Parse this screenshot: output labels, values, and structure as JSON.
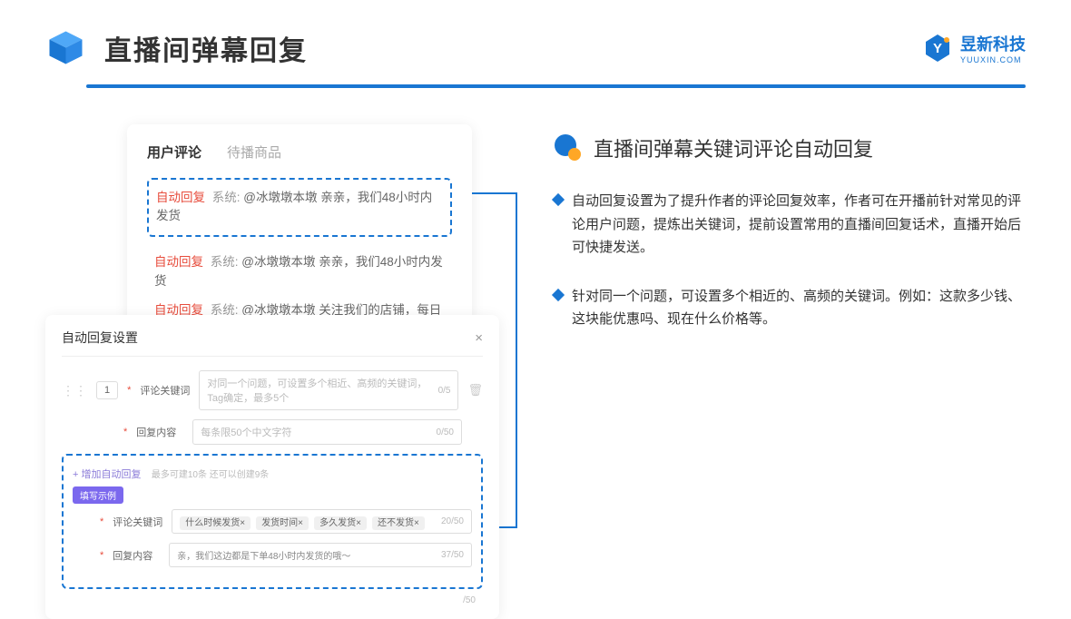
{
  "header": {
    "title": "直播间弹幕回复",
    "logo_cn": "昱新科技",
    "logo_en": "YUUXIN.COM"
  },
  "card1": {
    "tab_active": "用户评论",
    "tab_inactive": "待播商品",
    "auto_tag": "自动回复",
    "sys_tag": "系统:",
    "msg1": "@冰墩墩本墩 亲亲，我们48小时内发货",
    "msg2": "@冰墩墩本墩 亲亲，我们48小时内发货",
    "msg3": "@冰墩墩本墩 关注我们的店铺，每日都有热门推荐呦～"
  },
  "card2": {
    "modal_title": "自动回复设置",
    "num": "1",
    "label_keyword": "评论关键词",
    "placeholder_keyword": "对同一个问题，可设置多个相近、高频的关键词，Tag确定，最多5个",
    "counter_keyword": "0/5",
    "label_content": "回复内容",
    "placeholder_content": "每条限50个中文字符",
    "counter_content": "0/50",
    "add_link": "+ 增加自动回复",
    "add_note": "最多可建10条 还可以创建9条",
    "example_badge": "填写示例",
    "ex_label_keyword": "评论关键词",
    "tag1": "什么时候发货×",
    "tag2": "发货时间×",
    "tag3": "多久发货×",
    "tag4": "还不发货×",
    "ex_counter1": "20/50",
    "ex_label_content": "回复内容",
    "ex_content": "亲，我们这边都是下单48小时内发货的哦～",
    "ex_counter2": "37/50",
    "outer_counter": "/50"
  },
  "right": {
    "section_title": "直播间弹幕关键词评论自动回复",
    "bullet1": "自动回复设置为了提升作者的评论回复效率，作者可在开播前针对常见的评论用户问题，提炼出关键词，提前设置常用的直播间回复话术，直播开始后可快捷发送。",
    "bullet2": "针对同一个问题，可设置多个相近的、高频的关键词。例如：这款多少钱、这块能优惠吗、现在什么价格等。"
  }
}
